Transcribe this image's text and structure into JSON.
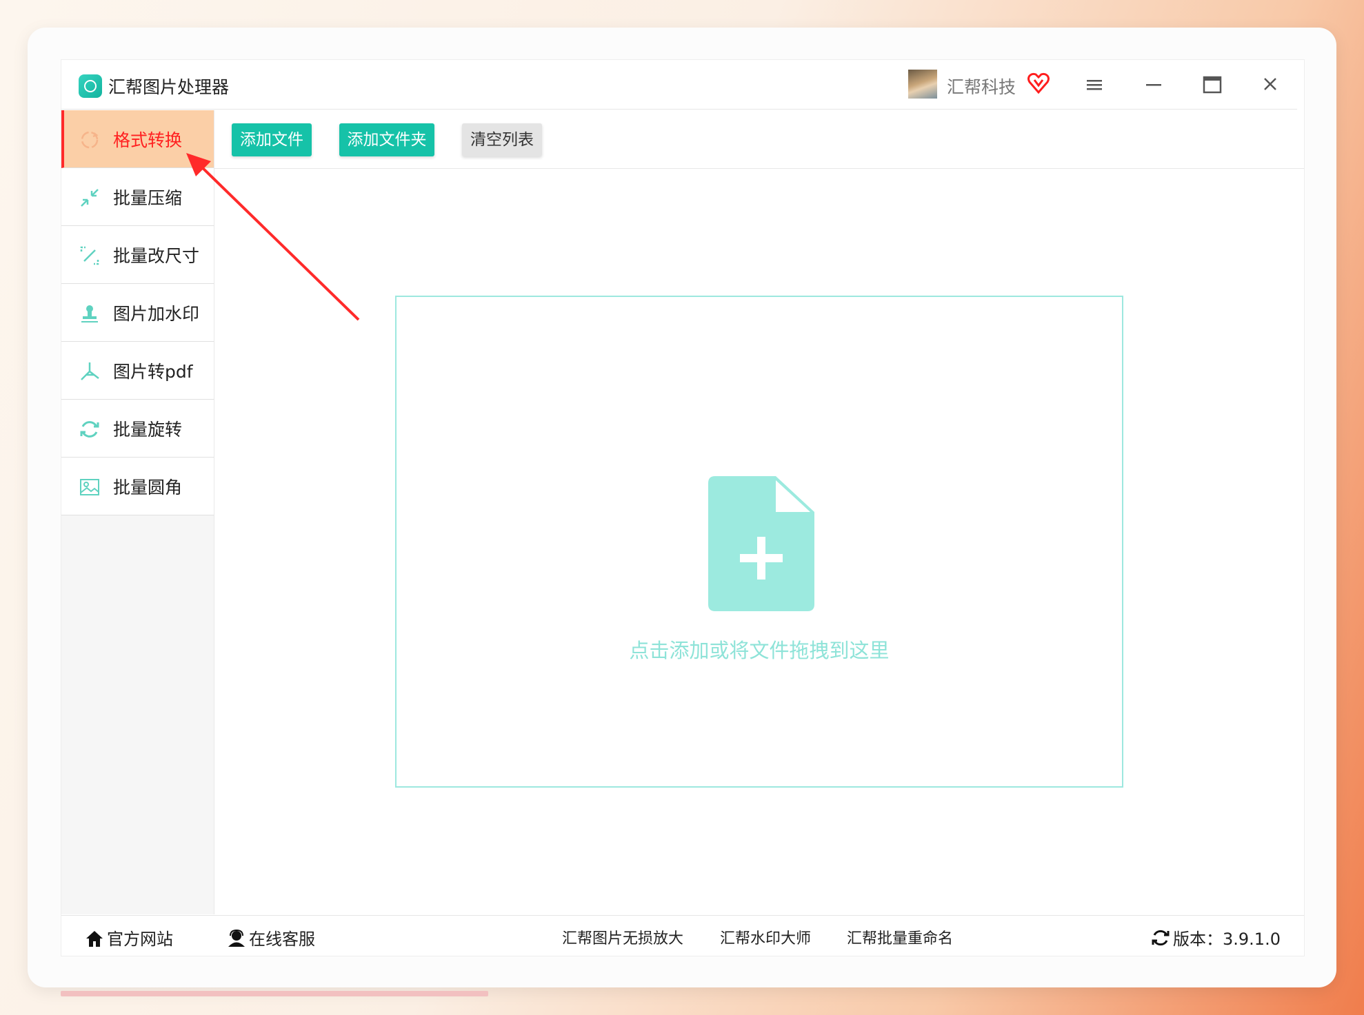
{
  "app": {
    "title": "汇帮图片处理器",
    "user_name": "汇帮科技"
  },
  "sidebar": {
    "items": [
      {
        "label": "格式转换",
        "icon": "convert-icon",
        "active": true
      },
      {
        "label": "批量压缩",
        "icon": "compress-icon",
        "active": false
      },
      {
        "label": "批量改尺寸",
        "icon": "resize-icon",
        "active": false
      },
      {
        "label": "图片加水印",
        "icon": "stamp-icon",
        "active": false
      },
      {
        "label": "图片转pdf",
        "icon": "pdf-icon",
        "active": false
      },
      {
        "label": "批量旋转",
        "icon": "rotate-icon",
        "active": false
      },
      {
        "label": "批量圆角",
        "icon": "image-icon",
        "active": false
      }
    ]
  },
  "toolbar": {
    "add_file": "添加文件",
    "add_folder": "添加文件夹",
    "clear_list": "清空列表"
  },
  "dropzone": {
    "hint": "点击添加或将文件拖拽到这里"
  },
  "footer": {
    "official_site": "官方网站",
    "online_service": "在线客服",
    "link1": "汇帮图片无损放大",
    "link2": "汇帮水印大师",
    "link3": "汇帮批量重命名",
    "version": "版本：3.9.1.0"
  },
  "colors": {
    "accent": "#16c2a8",
    "active_bg": "#fbcfa7",
    "active_text": "#ff2020",
    "drop_border": "#9de8df",
    "annotation": "#ff2a2a"
  }
}
